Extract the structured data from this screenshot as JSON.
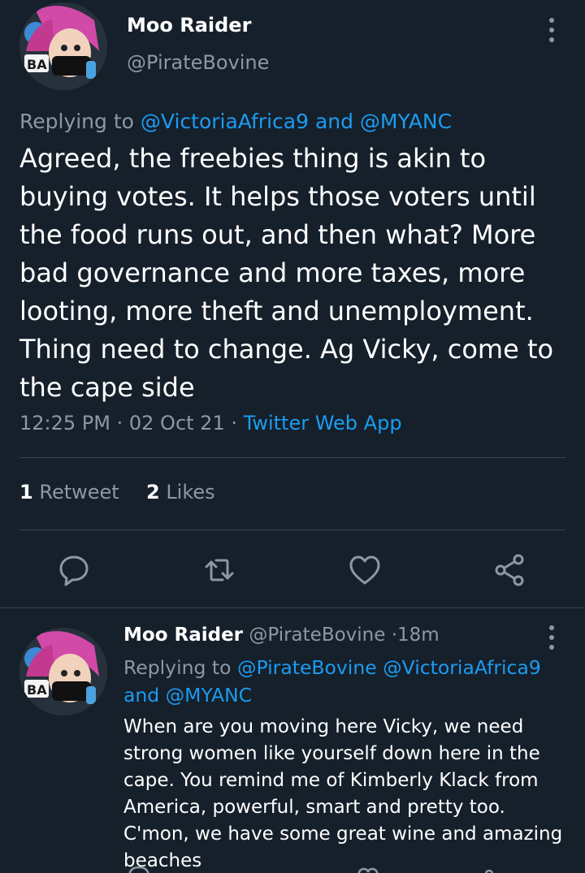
{
  "main_tweet": {
    "display_name": "Moo Raider",
    "handle": "@PirateBovine",
    "replying_prefix": "Replying to",
    "replying_to": "@VictoriaAfrica9 and @MYANC",
    "text": "Agreed, the freebies thing is akin to buying votes. It helps those voters until the food runs out, and then what? More bad governance and more taxes, more looting, more theft and unemployment. Thing need to change. Ag Vicky, come to the cape side",
    "time": "12:25 PM",
    "date": "02 Oct 21",
    "source": "Twitter Web App",
    "retweet_count": "1",
    "retweet_label": "Retweet",
    "like_count": "2",
    "like_label": "Likes"
  },
  "reply_tweet": {
    "display_name": "Moo Raider",
    "handle": "@PirateBovine",
    "age": "18m",
    "replying_prefix": "Replying to",
    "replying_to": "@PirateBovine @VictoriaAfrica9 and @MYANC",
    "text": "When are you moving here Vicky, we need strong women like yourself down here in the cape. You remind me of Kimberly Klack from America, powerful, smart and pretty too. C'mon, we have some great wine and amazing beaches"
  },
  "icons": {
    "reply": "reply-icon",
    "retweet": "retweet-icon",
    "like": "heart-icon",
    "share": "share-icon",
    "more": "more-vertical-icon"
  },
  "colors": {
    "background": "#15202b",
    "link": "#1d9bf0",
    "muted": "#8b98a5",
    "divider": "#38444d"
  }
}
